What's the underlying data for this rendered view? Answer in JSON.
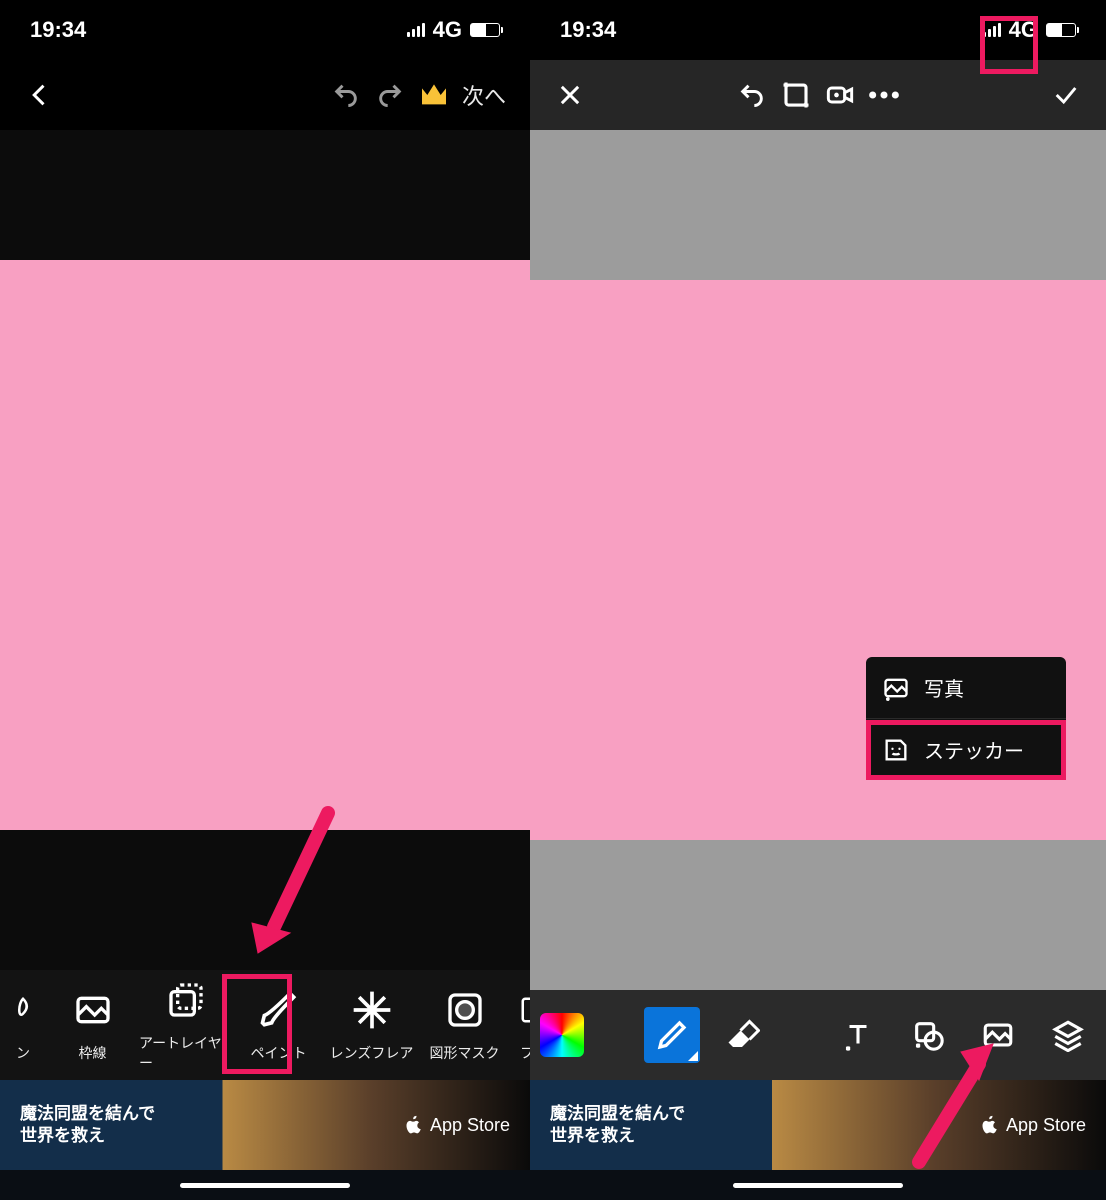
{
  "status": {
    "time": "19:34",
    "network": "4G"
  },
  "left": {
    "next": "次へ",
    "tools": [
      {
        "label": "ン"
      },
      {
        "label": "枠線"
      },
      {
        "label": "アートレイヤー"
      },
      {
        "label": "ペイント"
      },
      {
        "label": "レンズフレア"
      },
      {
        "label": "図形マスク"
      },
      {
        "label": "フレ"
      }
    ],
    "ad": {
      "line1": "魔法同盟を結んで",
      "line2": "世界を救え",
      "store": "App Store"
    },
    "colors": {
      "pink": "#f8a0c2",
      "highlight": "#ed1a60",
      "crown": "#f9c238"
    }
  },
  "right": {
    "popup": [
      {
        "label": "写真"
      },
      {
        "label": "ステッカー"
      }
    ],
    "ad": {
      "line1": "魔法同盟を結んで",
      "line2": "世界を救え",
      "store": "App Store"
    },
    "colors": {
      "pink": "#f8a0c2",
      "gray": "#9c9c9c",
      "active": "#0a74da",
      "highlight": "#ed1a60"
    }
  }
}
